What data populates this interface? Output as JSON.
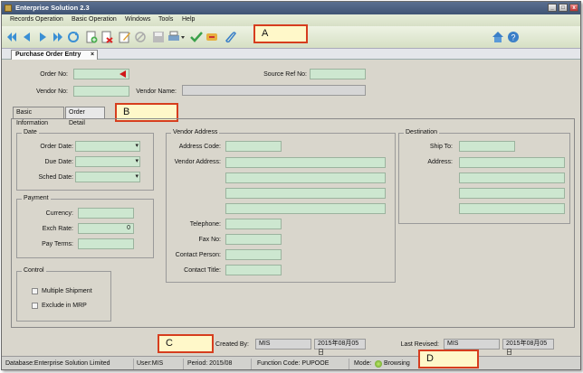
{
  "window": {
    "title": "Enterprise Solution  2.3",
    "min_label": "_",
    "max_label": "□",
    "close_label": "x"
  },
  "menu": {
    "items": [
      "Records Operation",
      "Basic Operation",
      "Windows",
      "Tools",
      "Help"
    ]
  },
  "callouts": {
    "a": "A",
    "b": "B",
    "c": "C",
    "d": "D"
  },
  "document_tab": {
    "label": "Purchase Order Entry",
    "close": "×"
  },
  "header": {
    "order_no_label": "Order No:",
    "order_no": "",
    "source_ref_label": "Source Ref No:",
    "source_ref": "",
    "vendor_no_label": "Vendor No:",
    "vendor_no": "",
    "vendor_name_label": "Vendor Name:",
    "vendor_name": ""
  },
  "tabs": [
    "Basic Information",
    "Order Detail"
  ],
  "date_group": {
    "title": "Date",
    "order_date_label": "Order Date:",
    "due_date_label": "Due Date:",
    "sched_date_label": "Sched Date:"
  },
  "payment_group": {
    "title": "Payment",
    "currency_label": "Currency:",
    "exch_rate_label": "Exch Rate:",
    "exch_rate": "0",
    "pay_terms_label": "Pay Terms:"
  },
  "control_group": {
    "title": "Control",
    "multiple_shipment": "Multiple Shipment",
    "exclude_mrp": "Exclude in MRP"
  },
  "vendor_address": {
    "title": "Vendor Address",
    "address_code_label": "Address Code:",
    "vendor_address_label": "Vendor Address:",
    "telephone_label": "Telephone:",
    "fax_label": "Fax No:",
    "contact_person_label": "Contact Person:",
    "contact_title_label": "Contact Title:"
  },
  "destination": {
    "title": "Destination",
    "ship_to_label": "Ship To:",
    "address_label": "Address:"
  },
  "audit": {
    "created_by_label": "Created By:",
    "created_by": "MIS",
    "created_date": "2015年08月05日",
    "last_revised_label": "Last Revised:",
    "last_revised_by": "MIS",
    "last_revised_date": "2015年08月05日"
  },
  "status": {
    "database": "Database:Enterprise Solution Limited",
    "user": "User:MIS",
    "period": "Period: 2015/08",
    "function_code": "Function Code:   PUPOOE",
    "mode_label": "Mode:",
    "mode": "Browsing"
  },
  "colors": {
    "field_bg": "#cde7d0",
    "callout_border": "#d63d1e",
    "callout_bg": "#fff8c9",
    "title_bar": "#4a5f80"
  }
}
